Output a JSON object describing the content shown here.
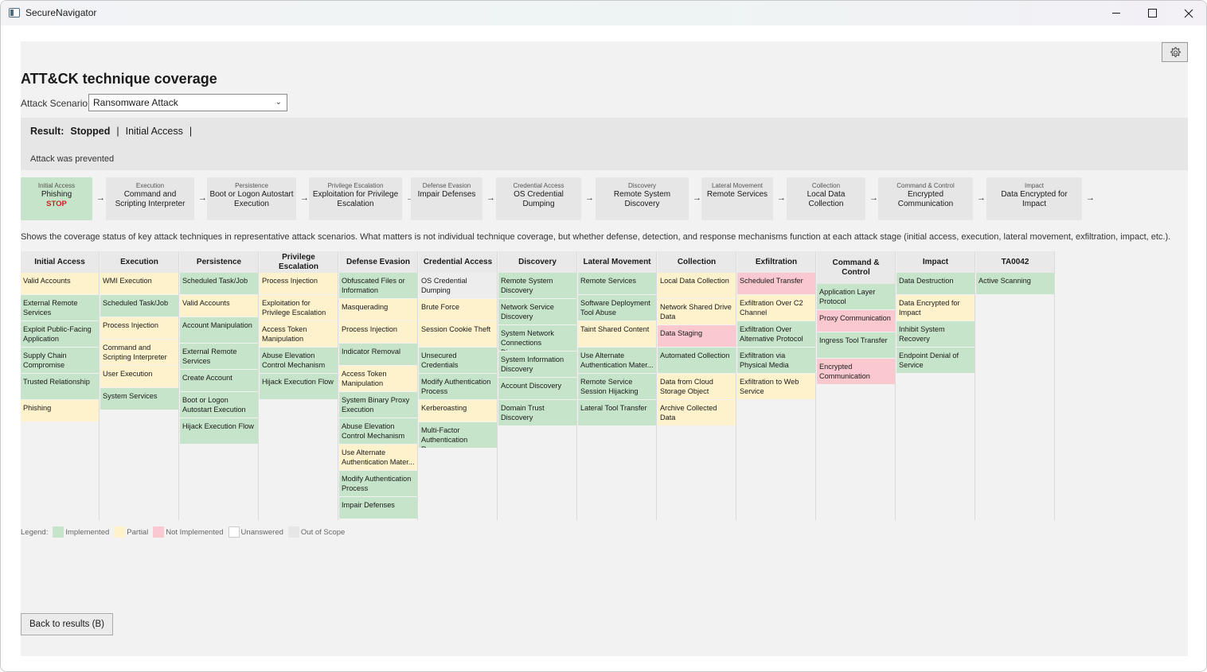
{
  "window": {
    "title": "SecureNavigator"
  },
  "page": {
    "title": "ATT&CK technique coverage",
    "scenario_label": "Attack Scenario:",
    "scenario_value": "Ransomware Attack",
    "back_button": "Back to results (B)",
    "description": "Shows the coverage status of key attack techniques in representative attack scenarios. What matters is not individual technique coverage, but whether defense, detection, and response mechanisms function at each attack stage (initial access, execution, lateral movement, exfiltration, impact, etc.)."
  },
  "result": {
    "label": "Result:",
    "value": "Stopped",
    "sep1": "|",
    "stage": "Initial Access",
    "sep2": "|",
    "message": "Attack was prevented"
  },
  "chain": [
    {
      "tactic": "Initial Access",
      "technique": "Phishing",
      "stop": "STOP"
    },
    {
      "tactic": "Execution",
      "technique": "Command and Scripting Interpreter"
    },
    {
      "tactic": "Persistence",
      "technique": "Boot or Logon Autostart Execution"
    },
    {
      "tactic": "Privilege Escalation",
      "technique": "Exploitation for Privilege Escalation"
    },
    {
      "tactic": "Defense Evasion",
      "technique": "Impair Defenses"
    },
    {
      "tactic": "Credential Access",
      "technique": "OS Credential Dumping"
    },
    {
      "tactic": "Discovery",
      "technique": "Remote System Discovery"
    },
    {
      "tactic": "Lateral Movement",
      "technique": "Remote Services"
    },
    {
      "tactic": "Collection",
      "technique": "Local Data Collection"
    },
    {
      "tactic": "Command & Control",
      "technique": "Encrypted Communication"
    },
    {
      "tactic": "Impact",
      "technique": "Data Encrypted for Impact"
    }
  ],
  "chain_arrow": "→",
  "matrix": [
    {
      "header": "Initial Access",
      "cells": [
        {
          "t": "Valid Accounts",
          "s": "part"
        },
        {
          "t": "External Remote Services",
          "s": "impl"
        },
        {
          "t": "Exploit Public-Facing Application",
          "s": "impl"
        },
        {
          "t": "Supply Chain Compromise",
          "s": "impl"
        },
        {
          "t": "Trusted Relationship",
          "s": "impl"
        },
        {
          "t": "Phishing",
          "s": "part"
        }
      ]
    },
    {
      "header": "Execution",
      "cells": [
        {
          "t": "WMI Execution",
          "s": "part"
        },
        {
          "t": "Scheduled Task/Job",
          "s": "impl"
        },
        {
          "t": "Process Injection",
          "s": "part"
        },
        {
          "t": "Command and Scripting Interpreter",
          "s": "part"
        },
        {
          "t": "User Execution",
          "s": "part"
        },
        {
          "t": "System Services",
          "s": "impl"
        }
      ]
    },
    {
      "header": "Persistence",
      "cells": [
        {
          "t": "Scheduled Task/Job",
          "s": "impl"
        },
        {
          "t": "Valid Accounts",
          "s": "part"
        },
        {
          "t": "Account Manipulation",
          "s": "impl"
        },
        {
          "t": "External Remote Services",
          "s": "impl"
        },
        {
          "t": "Create Account",
          "s": "impl"
        },
        {
          "t": "Boot or Logon Autostart Execution",
          "s": "impl"
        },
        {
          "t": "Hijack Execution Flow",
          "s": "impl"
        }
      ]
    },
    {
      "header": "Privilege Escalation",
      "cells": [
        {
          "t": "Process Injection",
          "s": "part"
        },
        {
          "t": "Exploitation for Privilege Escalation",
          "s": "part"
        },
        {
          "t": "Access Token Manipulation",
          "s": "part"
        },
        {
          "t": "Abuse Elevation Control Mechanism",
          "s": "impl"
        },
        {
          "t": "Hijack Execution Flow",
          "s": "impl"
        }
      ]
    },
    {
      "header": "Defense Evasion",
      "cells": [
        {
          "t": "Obfuscated Files or Information",
          "s": "impl"
        },
        {
          "t": "Masquerading",
          "s": "part"
        },
        {
          "t": "Process Injection",
          "s": "part"
        },
        {
          "t": "Indicator Removal",
          "s": "impl"
        },
        {
          "t": "Access Token Manipulation",
          "s": "part"
        },
        {
          "t": "System Binary Proxy Execution",
          "s": "impl"
        },
        {
          "t": "Abuse Elevation Control Mechanism",
          "s": "impl"
        },
        {
          "t": "Use Alternate Authentication Mater...",
          "s": "part"
        },
        {
          "t": "Modify Authentication Process",
          "s": "impl"
        },
        {
          "t": "Impair Defenses",
          "s": "impl"
        }
      ]
    },
    {
      "header": "Credential Access",
      "cells": [
        {
          "t": "OS Credential Dumping",
          "s": "unk"
        },
        {
          "t": "Brute Force",
          "s": "part"
        },
        {
          "t": "Session Cookie Theft",
          "s": "part"
        },
        {
          "t": "Unsecured Credentials",
          "s": "impl"
        },
        {
          "t": "Modify Authentication Process",
          "s": "impl"
        },
        {
          "t": "Kerberoasting",
          "s": "part"
        },
        {
          "t": "Multi-Factor Authentication Reque...",
          "s": "impl"
        }
      ]
    },
    {
      "header": "Discovery",
      "cells": [
        {
          "t": "Remote System Discovery",
          "s": "impl"
        },
        {
          "t": "Network Service Discovery",
          "s": "impl"
        },
        {
          "t": "System Network Connections Discovery",
          "s": "impl"
        },
        {
          "t": "System Information Discovery",
          "s": "impl"
        },
        {
          "t": "Account Discovery",
          "s": "impl"
        },
        {
          "t": "Domain Trust Discovery",
          "s": "impl"
        }
      ]
    },
    {
      "header": "Lateral Movement",
      "cells": [
        {
          "t": "Remote Services",
          "s": "impl"
        },
        {
          "t": "Software Deployment Tool Abuse",
          "s": "impl"
        },
        {
          "t": "Taint Shared Content",
          "s": "part"
        },
        {
          "t": "Use Alternate Authentication Mater...",
          "s": "impl"
        },
        {
          "t": "Remote Service Session Hijacking",
          "s": "impl"
        },
        {
          "t": "Lateral Tool Transfer",
          "s": "impl"
        }
      ]
    },
    {
      "header": "Collection",
      "cells": [
        {
          "t": "Local Data Collection",
          "s": "part"
        },
        {
          "t": "Network Shared Drive Data",
          "s": "part"
        },
        {
          "t": "Data Staging",
          "s": "not"
        },
        {
          "t": "Automated Collection",
          "s": "impl"
        },
        {
          "t": "Data from Cloud Storage Object",
          "s": "part"
        },
        {
          "t": "Archive Collected Data",
          "s": "part"
        }
      ]
    },
    {
      "header": "Exfiltration",
      "cells": [
        {
          "t": "Scheduled Transfer",
          "s": "not"
        },
        {
          "t": "Exfiltration Over C2 Channel",
          "s": "part"
        },
        {
          "t": "Exfiltration Over Alternative Protocol",
          "s": "impl"
        },
        {
          "t": "Exfiltration via Physical Media",
          "s": "impl"
        },
        {
          "t": "Exfiltration to Web Service",
          "s": "part"
        }
      ]
    },
    {
      "header": "Command & Control",
      "cells": [
        {
          "t": "Application Layer Protocol",
          "s": "impl"
        },
        {
          "t": "Proxy Communication",
          "s": "not"
        },
        {
          "t": "Ingress Tool Transfer",
          "s": "impl"
        },
        {
          "t": "Encrypted Communication",
          "s": "not"
        }
      ]
    },
    {
      "header": "Impact",
      "cells": [
        {
          "t": "Data Destruction",
          "s": "impl"
        },
        {
          "t": "Data Encrypted for Impact",
          "s": "part"
        },
        {
          "t": "Inhibit System Recovery",
          "s": "impl"
        },
        {
          "t": "Endpoint Denial of Service",
          "s": "impl"
        }
      ]
    },
    {
      "header": "TA0042",
      "cells": [
        {
          "t": "Active Scanning",
          "s": "impl"
        }
      ]
    }
  ],
  "legend": {
    "label": "Legend:",
    "items": [
      {
        "label": "Implemented",
        "color": "#c6e4c9"
      },
      {
        "label": "Partial",
        "color": "#fdf2cc"
      },
      {
        "label": "Not Implemented",
        "color": "#f9c9cf"
      },
      {
        "label": "Unanswered",
        "color": "#ffffff"
      },
      {
        "label": "Out of Scope",
        "color": "#e6e6e6"
      }
    ]
  },
  "colors": {
    "implemented": "#c6e4c9",
    "partial": "#fdf2cc",
    "not_implemented": "#f9c9cf",
    "stop": "#cc2222"
  }
}
